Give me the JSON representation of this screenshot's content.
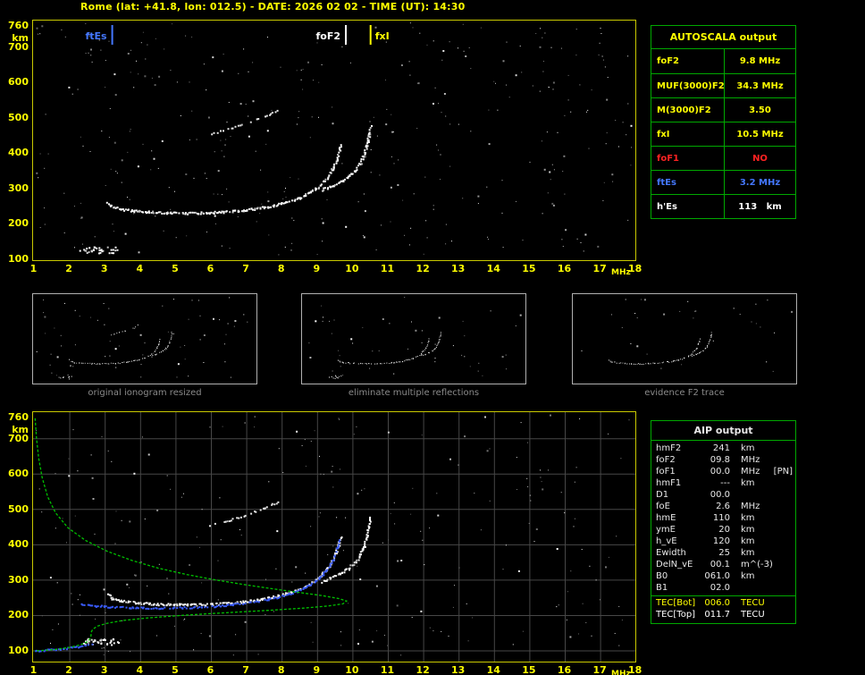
{
  "title": "Rome (lat: +41.8, lon: 012.5) - DATE: 2026 02 02 - TIME (UT): 14:30",
  "colors": {
    "accent_yellow": "#ffff00",
    "border_green": "#00a800",
    "alarm_red": "#ff2222",
    "es_blue": "#4477ff",
    "trace_blue": "#3a5cff",
    "profile_green": "#00c000",
    "plot_border_yellow": "#c9c900",
    "caption_gray": "#8a8a8a"
  },
  "axes": {
    "y_ticks": [
      760,
      700,
      600,
      500,
      400,
      300,
      200,
      100
    ],
    "y_unit": "km",
    "x_ticks": [
      1,
      2,
      3,
      4,
      5,
      6,
      7,
      8,
      9,
      10,
      11,
      12,
      13,
      14,
      15,
      16,
      17,
      18
    ],
    "x_unit": "MHz"
  },
  "autoscala_table": {
    "title": "AUTOSCALA output",
    "rows": [
      {
        "label": "foF2",
        "value": "9.8 MHz",
        "color": "#ffff00"
      },
      {
        "label": "MUF(3000)F2",
        "value": "34.3 MHz",
        "color": "#ffff00"
      },
      {
        "label": "M(3000)F2",
        "value": "3.50",
        "color": "#ffff00"
      },
      {
        "label": "fxI",
        "value": "10.5 MHz",
        "color": "#ffff00"
      },
      {
        "label": "foF1",
        "value": "NO",
        "color": "#ff2222"
      },
      {
        "label": "ftEs",
        "value": "3.2 MHz",
        "color": "#4477ff"
      },
      {
        "label": "h'Es",
        "value": "113   km",
        "color": "#ffffff"
      }
    ]
  },
  "thumbnails": [
    {
      "caption": "original ionogram resized",
      "series": [
        "F2-o",
        "F2-x",
        "second-hop",
        "Es"
      ],
      "noise": 70,
      "seed": 31
    },
    {
      "caption": "eliminate multiple reflections",
      "series": [
        "F2-o",
        "F2-x",
        "Es"
      ],
      "noise": 48,
      "seed": 37
    },
    {
      "caption": "evidence F2 trace",
      "series": [
        "F2-o",
        "F2-x"
      ],
      "noise": 32,
      "seed": 41
    }
  ],
  "aip_table": {
    "title": "AIP output",
    "rows": [
      {
        "label": "hmF2",
        "value": "241",
        "unit": "km"
      },
      {
        "label": "foF2",
        "value": "09.8",
        "unit": "MHz"
      },
      {
        "label": "foF1",
        "value": "00.0",
        "unit": "MHz",
        "note": "[PN]"
      },
      {
        "label": "hmF1",
        "value": "---",
        "unit": "km"
      },
      {
        "label": "D1",
        "value": "00.0",
        "unit": ""
      },
      {
        "label": "foE",
        "value": "2.6",
        "unit": "MHz"
      },
      {
        "label": "hmE",
        "value": "110",
        "unit": "km"
      },
      {
        "label": "ymE",
        "value": "20",
        "unit": "km"
      },
      {
        "label": "h_vE",
        "value": "120",
        "unit": "km"
      },
      {
        "label": "Ewidth",
        "value": "25",
        "unit": "km"
      },
      {
        "label": "DelN_vE",
        "value": "00.1",
        "unit": "m^(-3)"
      },
      {
        "label": "B0",
        "value": "061.0",
        "unit": "km"
      },
      {
        "label": "B1",
        "value": "02.0",
        "unit": ""
      },
      {
        "label": "TEC[Bot]",
        "value": "006.0",
        "unit": "TECU",
        "color": "#ffff00",
        "sep_before": true
      },
      {
        "label": "TEC[Top]",
        "value": "011.7",
        "unit": "TECU",
        "color": "#ffffff"
      }
    ]
  },
  "chart_data": [
    {
      "type": "scatter",
      "title": "ionogram with autoscaled characteristic frequencies",
      "xlabel": "MHz",
      "ylabel": "km",
      "xlim": [
        1,
        18
      ],
      "ylim": [
        100,
        760
      ],
      "grid": false,
      "noise_count": 380,
      "noise_seed": 11,
      "markers": [
        {
          "label": "ftEs",
          "x": 3.2,
          "color": "#4477ff",
          "side": "left"
        },
        {
          "label": "foF2",
          "x": 9.8,
          "color": "#ffffff",
          "side": "left"
        },
        {
          "label": "fxI",
          "x": 10.5,
          "color": "#ffff00",
          "side": "right"
        }
      ],
      "series": [
        {
          "name": "F2-o",
          "style": "trace",
          "color": "#ffffff",
          "points": [
            [
              3.05,
              262
            ],
            [
              3.2,
              250
            ],
            [
              3.45,
              243
            ],
            [
              3.8,
              238
            ],
            [
              4.2,
              235
            ],
            [
              4.7,
              233
            ],
            [
              5.3,
              232
            ],
            [
              5.9,
              233
            ],
            [
              6.4,
              236
            ],
            [
              6.9,
              240
            ],
            [
              7.3,
              246
            ],
            [
              7.7,
              253
            ],
            [
              8.1,
              263
            ],
            [
              8.5,
              276
            ],
            [
              8.8,
              292
            ],
            [
              9.05,
              310
            ],
            [
              9.25,
              332
            ],
            [
              9.4,
              356
            ],
            [
              9.52,
              382
            ],
            [
              9.6,
              408
            ],
            [
              9.64,
              425
            ]
          ]
        },
        {
          "name": "F2-x",
          "style": "trace",
          "color": "#ffffff",
          "points": [
            [
              9.1,
              298
            ],
            [
              9.35,
              307
            ],
            [
              9.6,
              319
            ],
            [
              9.85,
              334
            ],
            [
              10.05,
              352
            ],
            [
              10.2,
              374
            ],
            [
              10.3,
              398
            ],
            [
              10.38,
              424
            ],
            [
              10.44,
              452
            ],
            [
              10.48,
              478
            ]
          ]
        },
        {
          "name": "second-hop",
          "style": "dashed",
          "color": "#e8e8e8",
          "points": [
            [
              5.9,
              455
            ],
            [
              6.3,
              465
            ],
            [
              6.7,
              477
            ],
            [
              7.1,
              491
            ],
            [
              7.5,
              506
            ],
            [
              7.85,
              522
            ]
          ]
        },
        {
          "name": "Es",
          "style": "blob",
          "color": "#ffffff",
          "points": [
            [
              2.35,
              126
            ],
            [
              2.55,
              131
            ],
            [
              2.75,
              126
            ],
            [
              2.95,
              130
            ],
            [
              3.15,
              126
            ],
            [
              3.3,
              129
            ]
          ]
        }
      ]
    },
    {
      "type": "scatter",
      "title": "ionogram with restored trace and electron density profile",
      "xlabel": "MHz",
      "ylabel": "km",
      "xlim": [
        1,
        18
      ],
      "ylim": [
        100,
        760
      ],
      "grid": true,
      "noise_count": 240,
      "noise_seed": 23,
      "series": [
        {
          "name": "F2-o",
          "style": "trace",
          "color": "#ffffff",
          "points": [
            [
              3.05,
              262
            ],
            [
              3.2,
              250
            ],
            [
              3.45,
              243
            ],
            [
              3.8,
              238
            ],
            [
              4.2,
              235
            ],
            [
              4.7,
              233
            ],
            [
              5.3,
              232
            ],
            [
              5.9,
              233
            ],
            [
              6.4,
              236
            ],
            [
              6.9,
              240
            ],
            [
              7.3,
              246
            ],
            [
              7.7,
              253
            ],
            [
              8.1,
              263
            ],
            [
              8.5,
              276
            ],
            [
              8.8,
              292
            ],
            [
              9.05,
              310
            ],
            [
              9.25,
              332
            ],
            [
              9.4,
              356
            ],
            [
              9.52,
              382
            ],
            [
              9.6,
              408
            ],
            [
              9.64,
              425
            ]
          ]
        },
        {
          "name": "F2-x",
          "style": "trace",
          "color": "#ffffff",
          "points": [
            [
              9.1,
              298
            ],
            [
              9.35,
              307
            ],
            [
              9.6,
              319
            ],
            [
              9.85,
              334
            ],
            [
              10.05,
              352
            ],
            [
              10.2,
              374
            ],
            [
              10.3,
              398
            ],
            [
              10.38,
              424
            ],
            [
              10.44,
              452
            ],
            [
              10.48,
              478
            ]
          ]
        },
        {
          "name": "second-hop",
          "style": "dashed",
          "color": "#e8e8e8",
          "points": [
            [
              5.9,
              455
            ],
            [
              6.3,
              465
            ],
            [
              6.7,
              477
            ],
            [
              7.1,
              491
            ],
            [
              7.5,
              506
            ],
            [
              7.85,
              522
            ]
          ]
        },
        {
          "name": "Es",
          "style": "blob",
          "color": "#ffffff",
          "points": [
            [
              2.35,
              126
            ],
            [
              2.55,
              131
            ],
            [
              2.75,
              126
            ],
            [
              2.95,
              130
            ],
            [
              3.15,
              126
            ],
            [
              3.3,
              129
            ]
          ]
        },
        {
          "name": "restored-E",
          "style": "blue",
          "color": "#3a5cff",
          "points": [
            [
              1.0,
              102
            ],
            [
              1.35,
              104
            ],
            [
              1.7,
              107
            ],
            [
              2.05,
              111
            ],
            [
              2.4,
              116
            ],
            [
              2.6,
              120
            ]
          ]
        },
        {
          "name": "restored-F",
          "style": "blue",
          "color": "#3a5cff",
          "points": [
            [
              2.3,
              233
            ],
            [
              2.7,
              229
            ],
            [
              3.2,
              226
            ],
            [
              3.7,
              224
            ],
            [
              4.3,
              223
            ],
            [
              4.9,
              223
            ],
            [
              5.5,
              225
            ],
            [
              6.1,
              228
            ],
            [
              6.6,
              233
            ],
            [
              7.1,
              239
            ],
            [
              7.6,
              247
            ],
            [
              8.0,
              257
            ],
            [
              8.4,
              270
            ],
            [
              8.75,
              287
            ],
            [
              9.05,
              308
            ],
            [
              9.25,
              332
            ],
            [
              9.42,
              360
            ],
            [
              9.54,
              390
            ],
            [
              9.6,
              415
            ]
          ]
        },
        {
          "name": "Ne-profile",
          "style": "line",
          "color": "#00c000",
          "points": [
            [
              1.02,
              758
            ],
            [
              1.06,
              700
            ],
            [
              1.12,
              645
            ],
            [
              1.22,
              590
            ],
            [
              1.38,
              535
            ],
            [
              1.6,
              490
            ],
            [
              1.95,
              448
            ],
            [
              2.45,
              412
            ],
            [
              3.05,
              382
            ],
            [
              3.75,
              356
            ],
            [
              4.5,
              334
            ],
            [
              5.3,
              316
            ],
            [
              6.1,
              301
            ],
            [
              6.9,
              288
            ],
            [
              7.7,
              276
            ],
            [
              8.5,
              265
            ],
            [
              9.15,
              256
            ],
            [
              9.6,
              248
            ],
            [
              9.82,
              241
            ],
            [
              9.72,
              233
            ],
            [
              9.3,
              227
            ],
            [
              8.6,
              221
            ],
            [
              7.7,
              215
            ],
            [
              6.8,
              210
            ],
            [
              5.9,
              205
            ],
            [
              5.0,
              199
            ],
            [
              4.2,
              193
            ],
            [
              3.5,
              186
            ],
            [
              3.05,
              178
            ],
            [
              2.78,
              170
            ],
            [
              2.65,
              161
            ],
            [
              2.6,
              152
            ],
            [
              2.6,
              143
            ],
            [
              2.57,
              134
            ],
            [
              2.5,
              126
            ],
            [
              2.3,
              117
            ],
            [
              2.0,
              110
            ],
            [
              1.6,
              104
            ],
            [
              1.2,
              101
            ],
            [
              1.0,
              100
            ]
          ]
        }
      ]
    }
  ]
}
